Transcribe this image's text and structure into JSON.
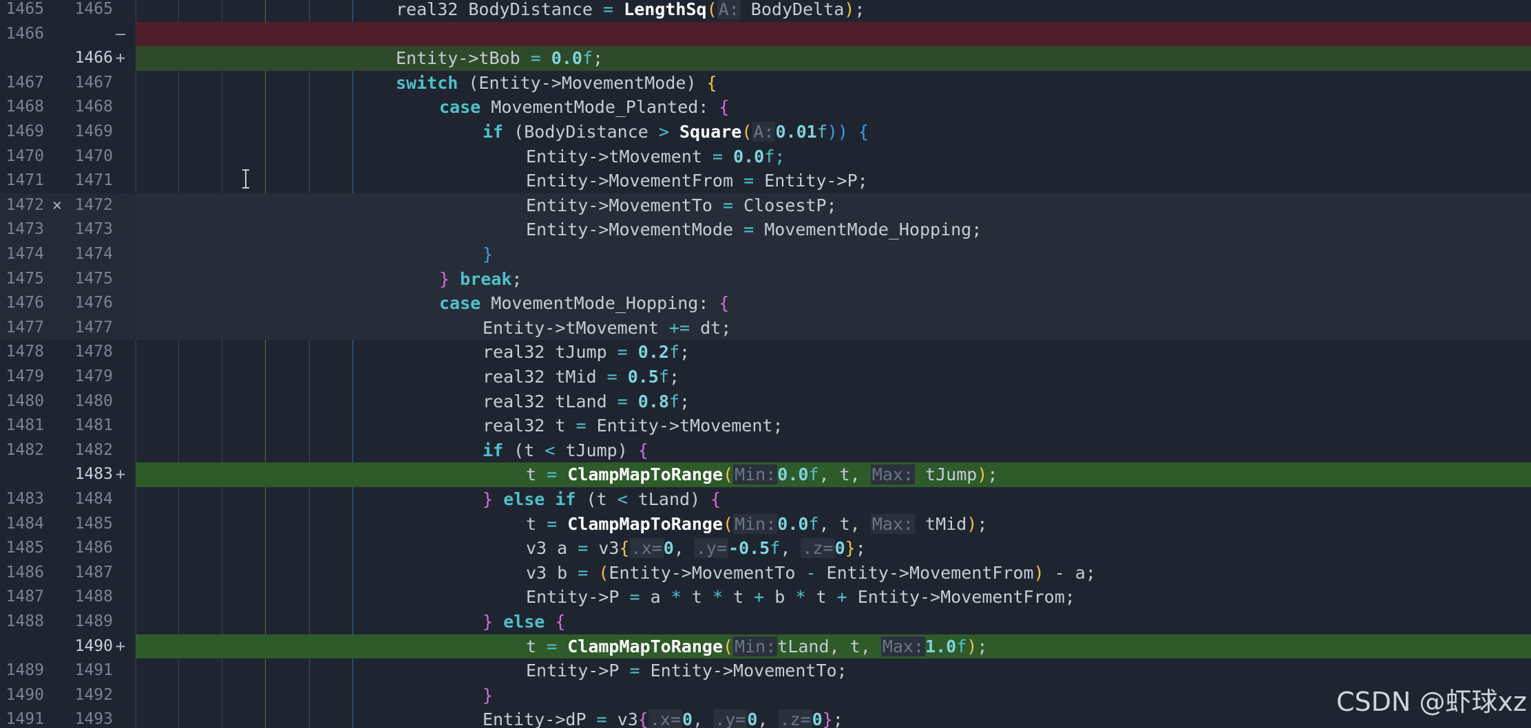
{
  "rows": [
    {
      "old": "1465",
      "new": "1465",
      "marker": "",
      "state": "plain"
    },
    {
      "old": "1466",
      "new": "",
      "marker": "—",
      "state": "removed"
    },
    {
      "old": "",
      "new": "1466",
      "marker": "+",
      "state": "added"
    },
    {
      "old": "1467",
      "new": "1467",
      "marker": "",
      "state": "plain"
    },
    {
      "old": "1468",
      "new": "1468",
      "marker": "",
      "state": "plain"
    },
    {
      "old": "1469",
      "new": "1469",
      "marker": "",
      "state": "plain"
    },
    {
      "old": "1470",
      "new": "1470",
      "marker": "",
      "state": "plain"
    },
    {
      "old": "1471",
      "new": "1471",
      "marker": "",
      "state": "plain"
    },
    {
      "old": "1472",
      "new": "1472",
      "marker": "",
      "mid_marker": "⨯",
      "state": "hunk"
    },
    {
      "old": "1473",
      "new": "1473",
      "marker": "",
      "state": "hunk"
    },
    {
      "old": "1474",
      "new": "1474",
      "marker": "",
      "state": "hunk"
    },
    {
      "old": "1475",
      "new": "1475",
      "marker": "",
      "state": "hunk"
    },
    {
      "old": "1476",
      "new": "1476",
      "marker": "",
      "state": "hunk"
    },
    {
      "old": "1477",
      "new": "1477",
      "marker": "",
      "state": "hunk"
    },
    {
      "old": "1478",
      "new": "1478",
      "marker": "",
      "state": "plain"
    },
    {
      "old": "1479",
      "new": "1479",
      "marker": "",
      "state": "plain"
    },
    {
      "old": "1480",
      "new": "1480",
      "marker": "",
      "state": "plain"
    },
    {
      "old": "1481",
      "new": "1481",
      "marker": "",
      "state": "plain"
    },
    {
      "old": "1482",
      "new": "1482",
      "marker": "",
      "state": "plain"
    },
    {
      "old": "",
      "new": "1483",
      "marker": "+",
      "state": "added-strong"
    },
    {
      "old": "1483",
      "new": "1484",
      "marker": "",
      "state": "plain"
    },
    {
      "old": "1484",
      "new": "1485",
      "marker": "",
      "state": "plain"
    },
    {
      "old": "1485",
      "new": "1486",
      "marker": "",
      "state": "plain"
    },
    {
      "old": "1486",
      "new": "1487",
      "marker": "",
      "state": "plain"
    },
    {
      "old": "1487",
      "new": "1488",
      "marker": "",
      "state": "plain"
    },
    {
      "old": "1488",
      "new": "1489",
      "marker": "",
      "state": "plain"
    },
    {
      "old": "",
      "new": "1490",
      "marker": "+",
      "state": "added-strong"
    },
    {
      "old": "1489",
      "new": "1491",
      "marker": "",
      "state": "plain"
    },
    {
      "old": "1490",
      "new": "1492",
      "marker": "",
      "state": "plain"
    },
    {
      "old": "1491",
      "new": "1493",
      "marker": "",
      "state": "plain"
    }
  ],
  "code": {
    "l0a": "real32 BodyDistance ",
    "l0b": "=",
    "l0c": " ",
    "l0fn": "LengthSq",
    "l0hint": "A:",
    "l0arg": " BodyDelta",
    "l0end": ";",
    "l2a": "Entity->tBob ",
    "l2op": "=",
    "l2num": " 0.0",
    "l2f": "f",
    "l2end": ";",
    "l3kw": "switch",
    "l3a": " (Entity->MovementMode) ",
    "l4kw": "case",
    "l4a": " MovementMode_Planted: ",
    "l5kw": "if",
    "l5a": " (BodyDistance ",
    "l5op": ">",
    "l5fn": " Square",
    "l5hint": "A:",
    "l5num": "0.01",
    "l5f": "f",
    "l5b": ")) ",
    "l6a": "Entity->tMovement ",
    "l6num": "0.0",
    "l6f": "f;",
    "l7a": "Entity->MovementFrom ",
    "l7b": " Entity->P;",
    "l8a": "Entity->MovementTo ",
    "l8b": " ClosestP;",
    "l9a": "Entity->MovementMode ",
    "l9b": " MovementMode_Hopping;",
    "l11kw": "break",
    "l12kw": "case",
    "l12a": " MovementMode_Hopping: ",
    "l13a": "Entity->tMovement ",
    "l13op": "+=",
    "l13b": " dt;",
    "l14a": "real32 tJump ",
    "l14num": "0.2",
    "l15a": "real32 tMid ",
    "l15num": "0.5",
    "l16a": "real32 tLand ",
    "l16num": "0.8",
    "l17a": "real32 t ",
    "l17b": " Entity->tMovement;",
    "l18kw": "if",
    "l18a": " (t ",
    "l18op": "<",
    "l18b": " tJump) ",
    "l19a": "t ",
    "l19fn": " ClampMapToRange",
    "l19hmin": "Min:",
    "l19num": "0.0",
    "l19b": ", t, ",
    "l19hmax": "Max:",
    "l19c": " tJump",
    "l20kw": " else if",
    "l20a": " (t ",
    "l20b": " tLand) ",
    "l21c": " tMid",
    "l22a": "v3 a ",
    "l22b": " v3",
    "l22hx": ".x=",
    "l22n0": "0",
    "l22hy": ".y=",
    "l22ny": "-0.5",
    "l22hz": ".z=",
    "l22nz": "0",
    "l23a": "v3 b ",
    "l23b": "Entity->MovementTo ",
    "l23op": "-",
    "l23c": " Entity->MovementFrom",
    "l23d": " - a;",
    "l24a": "Entity->P ",
    "l24b": " a ",
    "l24c": " t ",
    "l24d": " t ",
    "l24e": " b ",
    "l24g": " t ",
    "l24h": " Entity->MovementFrom;",
    "l25kw": " else ",
    "l26c": "tLand",
    "l26num": "1.0",
    "l27a": "Entity->P ",
    "l27b": " Entity->MovementTo;",
    "l29a": "Entity->dP ",
    "l29b": " v3",
    "l29n0": "0",
    "l29ny": "0",
    "l29nz": "0"
  },
  "symbols": {
    "eq": "=",
    "semi": ";",
    "star": "*",
    "plus": "+",
    "comma": ", ",
    "lbrace": "{",
    "rbrace": "}",
    "lparen": "(",
    "rparen": ")",
    "f": "f",
    "space": " "
  },
  "watermark": "CSDN @虾球xz"
}
